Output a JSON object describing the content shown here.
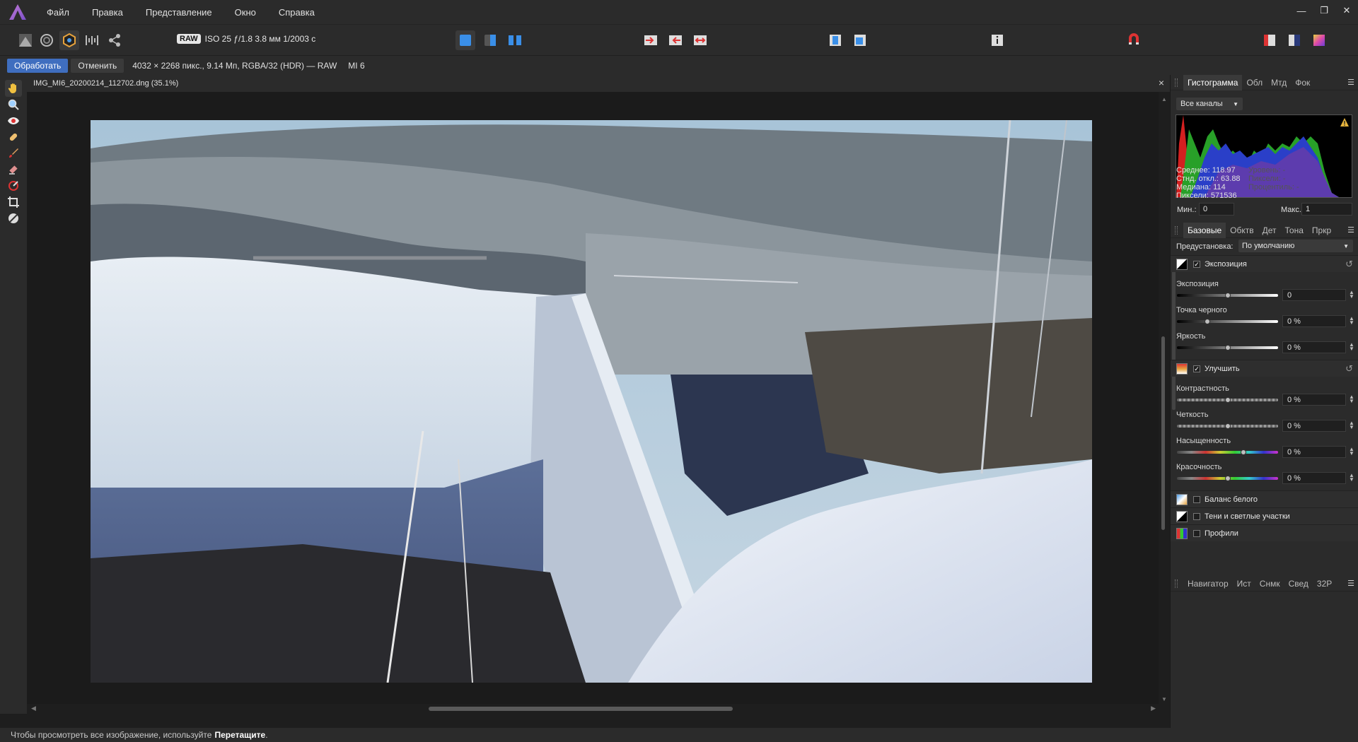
{
  "menubar": {
    "items": [
      "Файл",
      "Правка",
      "Представление",
      "Окно",
      "Справка"
    ],
    "win_min": "—",
    "win_restore": "❐",
    "win_close": "✕"
  },
  "toolbar": {
    "raw_badge": "RAW",
    "exif": "ISO 25  ƒ/1.8 3.8 мм  1/2003 с"
  },
  "contextbar": {
    "develop_label": "Обработать",
    "cancel_label": "Отменить",
    "image_info": "4032 × 2268 пикс., 9.14 Мп, RGBA/32 (HDR) — RAW",
    "camera": "MI 6"
  },
  "document": {
    "tab_title": "IMG_MI6_20200214_112702.dng (35.1%)",
    "close": "×"
  },
  "statusbar": {
    "text": "Чтобы просмотреть все изображение, используйте",
    "bold": "Перетащите",
    "end": "."
  },
  "histogram_panel": {
    "tabs": [
      "Гистограмма",
      "Обл",
      "Мтд",
      "Фок"
    ],
    "channel": "Все каналы",
    "stats": {
      "mean": "Среднее: 118.97",
      "stddev": "Стнд. откл.: 63.88",
      "median": "Медиана: 114",
      "pixels": "Пиксели: 571536",
      "level": "Уровень: -",
      "count": "Пиксели: -",
      "percentile": "Процентиль: -"
    },
    "min_label": "Мин.:",
    "min_value": "0",
    "max_label": "Макс.:",
    "max_value": "1"
  },
  "basic_panel": {
    "tabs": [
      "Базовые",
      "Обктв",
      "Дет",
      "Тона",
      "Пркр"
    ],
    "preset_label": "Предустановка:",
    "preset_value": "По умолчанию",
    "exposure_section": "Экспозиция",
    "enhance_section": "Улучшить",
    "white_balance_section": "Баланс белого",
    "shadows_section": "Тени и светлые участки",
    "profiles_section": "Профили",
    "sliders": {
      "exposure": {
        "label": "Экспозиция",
        "value": "0",
        "pos": 0.5
      },
      "black_point": {
        "label": "Точка черного",
        "value": "0 %",
        "pos": 0.3
      },
      "brightness": {
        "label": "Яркость",
        "value": "0 %",
        "pos": 0.5
      },
      "contrast": {
        "label": "Контрастность",
        "value": "0 %",
        "pos": 0.5
      },
      "clarity": {
        "label": "Четкость",
        "value": "0 %",
        "pos": 0.5
      },
      "saturation": {
        "label": "Насыщенность",
        "value": "0 %",
        "pos": 0.66
      },
      "vibrance": {
        "label": "Красочность",
        "value": "0 %",
        "pos": 0.5
      }
    }
  },
  "bottom_panel": {
    "tabs": [
      "Навигатор",
      "Ист",
      "Снмк",
      "Свед",
      "32P"
    ]
  },
  "icons": {
    "warning": "warning-icon",
    "reset": "reset-icon"
  }
}
